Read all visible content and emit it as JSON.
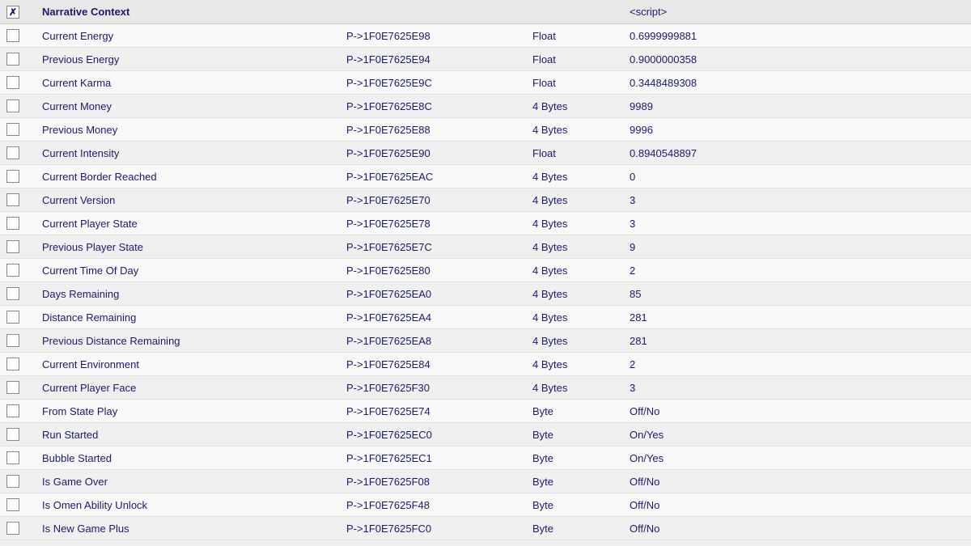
{
  "colors": {
    "text": "#1a1a6e",
    "bg": "#f0f0f0",
    "header_bg": "#e8e8e8"
  },
  "header": {
    "label": "Narrative Context",
    "script_label": "<script>"
  },
  "columns": {
    "name_header": "",
    "address_header": "",
    "type_header": "",
    "value_header": ""
  },
  "rows": [
    {
      "name": "Current Energy",
      "address": "P->1F0E7625E98",
      "type": "Float",
      "value": "0.6999999881",
      "checked": false
    },
    {
      "name": "Previous Energy",
      "address": "P->1F0E7625E94",
      "type": "Float",
      "value": "0.9000000358",
      "checked": false
    },
    {
      "name": "Current Karma",
      "address": "P->1F0E7625E9C",
      "type": "Float",
      "value": "0.3448489308",
      "checked": false
    },
    {
      "name": "Current Money",
      "address": "P->1F0E7625E8C",
      "type": "4 Bytes",
      "value": "9989",
      "checked": false
    },
    {
      "name": "Previous Money",
      "address": "P->1F0E7625E88",
      "type": "4 Bytes",
      "value": "9996",
      "checked": false
    },
    {
      "name": "Current Intensity",
      "address": "P->1F0E7625E90",
      "type": "Float",
      "value": "0.8940548897",
      "checked": false
    },
    {
      "name": "Current Border Reached",
      "address": "P->1F0E7625EAC",
      "type": "4 Bytes",
      "value": "0",
      "checked": false
    },
    {
      "name": "Current Version",
      "address": "P->1F0E7625E70",
      "type": "4 Bytes",
      "value": "3",
      "checked": false
    },
    {
      "name": "Current Player State",
      "address": "P->1F0E7625E78",
      "type": "4 Bytes",
      "value": "3",
      "checked": false
    },
    {
      "name": "Previous Player State",
      "address": "P->1F0E7625E7C",
      "type": "4 Bytes",
      "value": "9",
      "checked": false
    },
    {
      "name": "Current Time Of Day",
      "address": "P->1F0E7625E80",
      "type": "4 Bytes",
      "value": "2",
      "checked": false
    },
    {
      "name": "Days Remaining",
      "address": "P->1F0E7625EA0",
      "type": "4 Bytes",
      "value": "85",
      "checked": false
    },
    {
      "name": "Distance Remaining",
      "address": "P->1F0E7625EA4",
      "type": "4 Bytes",
      "value": "281",
      "checked": false
    },
    {
      "name": "Previous Distance Remaining",
      "address": "P->1F0E7625EA8",
      "type": "4 Bytes",
      "value": "281",
      "checked": false
    },
    {
      "name": "Current Environment",
      "address": "P->1F0E7625E84",
      "type": "4 Bytes",
      "value": "2",
      "checked": false
    },
    {
      "name": "Current Player Face",
      "address": "P->1F0E7625F30",
      "type": "4 Bytes",
      "value": "3",
      "checked": false
    },
    {
      "name": "From State Play",
      "address": "P->1F0E7625E74",
      "type": "Byte",
      "value": "Off/No",
      "checked": false
    },
    {
      "name": "Run Started",
      "address": "P->1F0E7625EC0",
      "type": "Byte",
      "value": "On/Yes",
      "checked": false
    },
    {
      "name": "Bubble Started",
      "address": "P->1F0E7625EC1",
      "type": "Byte",
      "value": "On/Yes",
      "checked": false
    },
    {
      "name": "Is Game Over",
      "address": "P->1F0E7625F08",
      "type": "Byte",
      "value": "Off/No",
      "checked": false
    },
    {
      "name": "Is Omen Ability Unlock",
      "address": "P->1F0E7625F48",
      "type": "Byte",
      "value": "Off/No",
      "checked": false
    },
    {
      "name": "Is New Game Plus",
      "address": "P->1F0E7625FC0",
      "type": "Byte",
      "value": "Off/No",
      "checked": false
    }
  ]
}
